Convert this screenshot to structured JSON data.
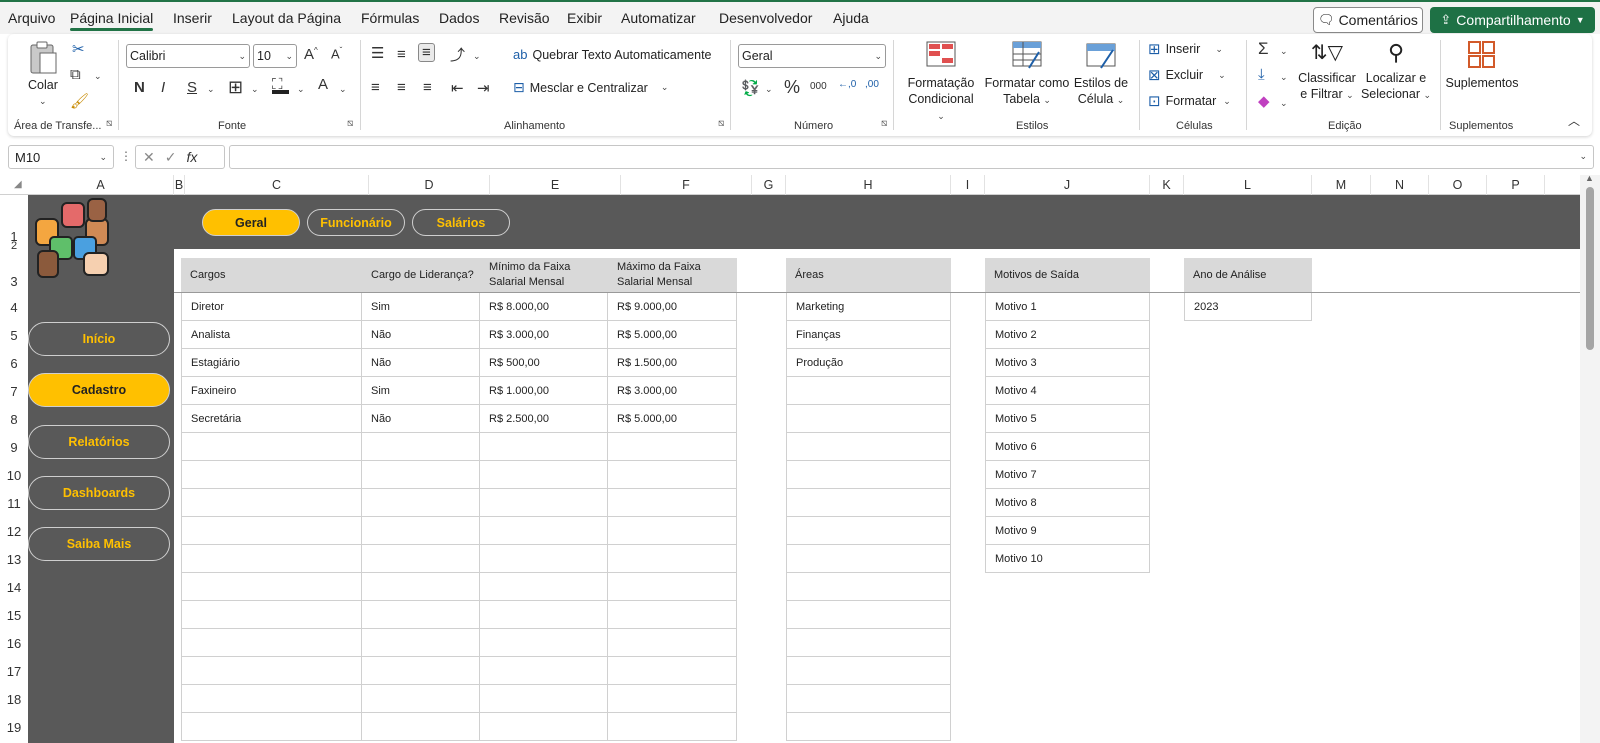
{
  "menu": {
    "tabs": [
      "Arquivo",
      "Página Inicial",
      "Inserir",
      "Layout da Página",
      "Fórmulas",
      "Dados",
      "Revisão",
      "Exibir",
      "Automatizar",
      "Desenvolvedor",
      "Ajuda"
    ],
    "active_tab": "Página Inicial",
    "comments_label": "Comentários",
    "share_label": "Compartilhamento"
  },
  "ribbon": {
    "clipboard": {
      "paste_label": "Colar",
      "group_label": "Área de Transfe..."
    },
    "font": {
      "font_name": "Calibri",
      "font_size": "10",
      "bold": "N",
      "italic": "I",
      "underline": "S",
      "group_label": "Fonte"
    },
    "alignment": {
      "wrap_text": "Quebrar Texto Automaticamente",
      "merge_center": "Mesclar e Centralizar",
      "group_label": "Alinhamento"
    },
    "number": {
      "format": "Geral",
      "group_label": "Número"
    },
    "styles": {
      "conditional_1": "Formatação",
      "conditional_2": "Condicional",
      "table_1": "Formatar como",
      "table_2": "Tabela",
      "cell_1": "Estilos de",
      "cell_2": "Célula",
      "group_label": "Estilos"
    },
    "cells": {
      "insert": "Inserir",
      "delete": "Excluir",
      "format": "Formatar",
      "group_label": "Células"
    },
    "editing": {
      "sort_1": "Classificar",
      "sort_2": "e Filtrar",
      "find_1": "Localizar e",
      "find_2": "Selecionar",
      "group_label": "Edição"
    },
    "addins": {
      "label": "Suplementos",
      "group_label": "Suplementos"
    }
  },
  "formula_bar": {
    "name_box": "M10",
    "formula": ""
  },
  "columns": [
    "A",
    "B",
    "C",
    "D",
    "E",
    "F",
    "G",
    "H",
    "I",
    "J",
    "K",
    "L",
    "M",
    "N",
    "O",
    "P"
  ],
  "rows": [
    "1",
    "2",
    "3",
    "4",
    "5",
    "6",
    "7",
    "8",
    "9",
    "10",
    "11",
    "12",
    "13",
    "14",
    "15",
    "16",
    "17",
    "18",
    "19"
  ],
  "top_tabs": [
    "Geral",
    "Funcionário",
    "Salários"
  ],
  "active_top_tab": "Geral",
  "side_nav": [
    "Início",
    "Cadastro",
    "Relatórios",
    "Dashboards",
    "Saiba Mais"
  ],
  "active_side_nav": "Cadastro",
  "cargos_table": {
    "headers": [
      "Cargos",
      "Cargo de Liderança?",
      "Mínimo da Faixa Salarial Mensal",
      "Máximo da Faixa Salarial Mensal"
    ],
    "rows": [
      [
        "Diretor",
        "Sim",
        "R$ 8.000,00",
        "R$ 9.000,00"
      ],
      [
        "Analista",
        "Não",
        "R$ 3.000,00",
        "R$ 5.000,00"
      ],
      [
        "Estagiário",
        "Não",
        "R$ 500,00",
        "R$ 1.500,00"
      ],
      [
        "Faxineiro",
        "Sim",
        "R$ 1.000,00",
        "R$ 3.000,00"
      ],
      [
        "Secretária",
        "Não",
        "R$ 2.500,00",
        "R$ 5.000,00"
      ]
    ]
  },
  "areas_table": {
    "header": "Áreas",
    "rows": [
      "Marketing",
      "Finanças",
      "Produção"
    ]
  },
  "motivos_table": {
    "header": "Motivos de Saída",
    "rows": [
      "Motivo 1",
      "Motivo 2",
      "Motivo 3",
      "Motivo 4",
      "Motivo 5",
      "Motivo 6",
      "Motivo 7",
      "Motivo 8",
      "Motivo 9",
      "Motivo 10"
    ]
  },
  "ano_table": {
    "header": "Ano de Análise",
    "rows": [
      "2023"
    ]
  },
  "colors": {
    "excel_green": "#217346",
    "share_green": "#1e7145",
    "dashboard_gray": "#595959",
    "accent_yellow": "#ffc000",
    "header_gray": "#d9d9d9"
  }
}
